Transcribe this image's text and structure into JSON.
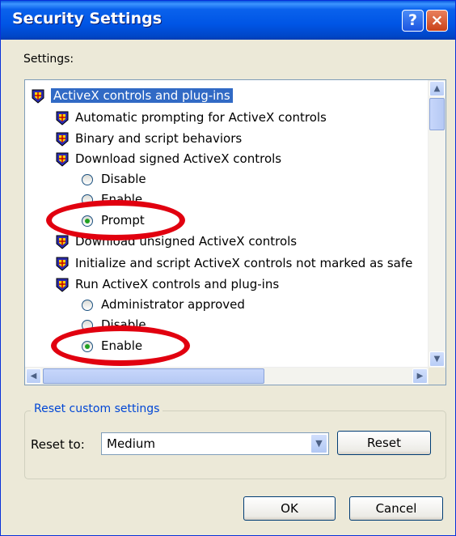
{
  "window": {
    "title": "Security Settings",
    "help_label": "?",
    "close_label": "×"
  },
  "settings_label": "Settings:",
  "tree": {
    "items": [
      {
        "kind": "category",
        "label": "ActiveX controls and plug-ins",
        "selected": true
      },
      {
        "kind": "setting",
        "label": "Automatic prompting for ActiveX controls"
      },
      {
        "kind": "setting",
        "label": "Binary and script behaviors"
      },
      {
        "kind": "setting",
        "label": "Download signed ActiveX controls"
      },
      {
        "kind": "option",
        "label": "Disable",
        "checked": false
      },
      {
        "kind": "option",
        "label": "Enable",
        "checked": false
      },
      {
        "kind": "option",
        "label": "Prompt",
        "checked": true
      },
      {
        "kind": "setting",
        "label": "Download unsigned ActiveX controls"
      },
      {
        "kind": "setting",
        "label": "Initialize and script ActiveX controls not marked as safe"
      },
      {
        "kind": "setting",
        "label": "Run ActiveX controls and plug-ins"
      },
      {
        "kind": "option",
        "label": "Administrator approved",
        "checked": false
      },
      {
        "kind": "option",
        "label": "Disable",
        "checked": false
      },
      {
        "kind": "option",
        "label": "Enable",
        "checked": true
      }
    ]
  },
  "reset_group": {
    "label": "Reset custom settings",
    "reset_to_label": "Reset to:",
    "selected_level": "Medium",
    "reset_button": "Reset"
  },
  "buttons": {
    "ok": "OK",
    "cancel": "Cancel"
  },
  "colors": {
    "title_blue": "#0055e5",
    "selection": "#316ac5",
    "annotation_red": "#e1000f"
  }
}
